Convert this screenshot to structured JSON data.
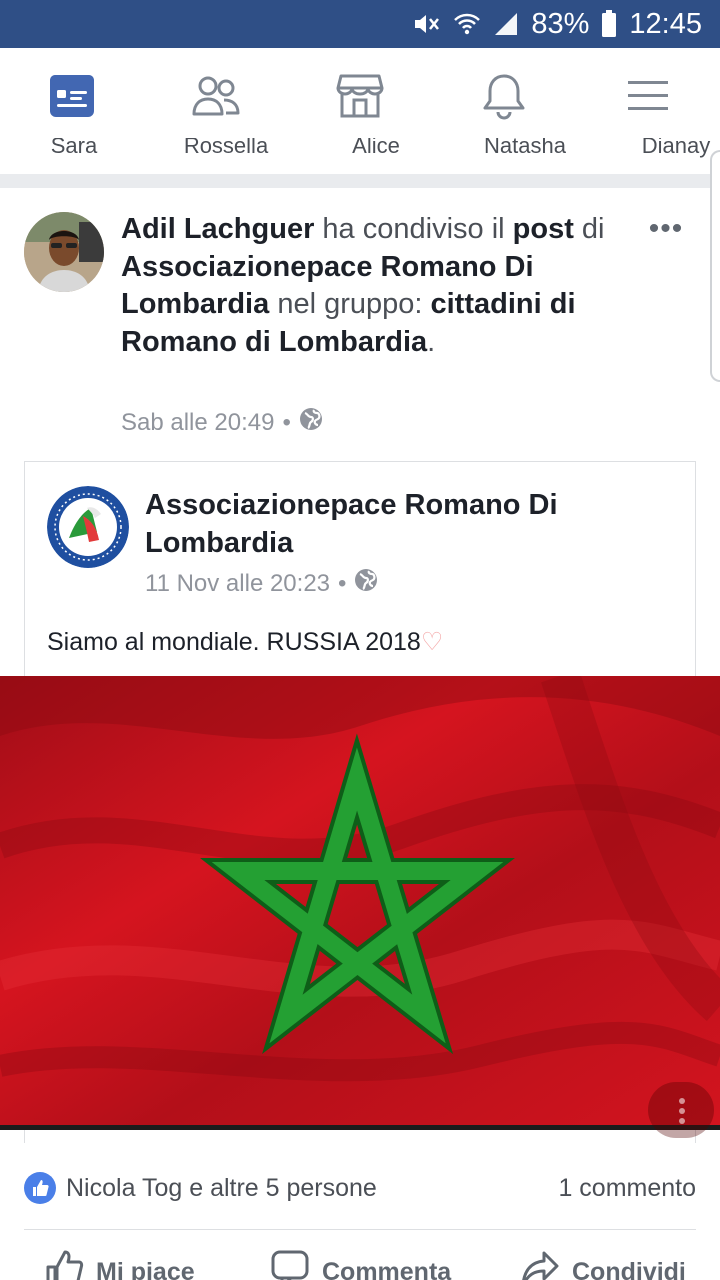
{
  "status_bar": {
    "battery": "83%",
    "time": "12:45",
    "icons": [
      "mute-icon",
      "wifi-icon",
      "signal-icon",
      "battery-icon"
    ]
  },
  "nav": {
    "icons": [
      "news-feed-icon",
      "friends-icon",
      "marketplace-icon",
      "notifications-icon",
      "menu-icon"
    ],
    "active": "news-feed-icon",
    "active_color": "#4267b2",
    "inactive_color": "#7f8792"
  },
  "stories": [
    "Sara",
    "Rossella",
    "Alice",
    "Natasha",
    "Dianay"
  ],
  "post": {
    "author": "Adil Lachguer",
    "action": "ha condiviso il",
    "post_word": "post",
    "of_word": "di",
    "source_page": "Associazionepace Romano Di Lombardia",
    "in_group_text": "nel gruppo:",
    "group": "cittadini di Romano di Lombardia",
    "period": ".",
    "time": "Sab alle 20:49",
    "audience_icon": "globe-icon",
    "more_icon": "more-icon"
  },
  "shared": {
    "page_name": "Associazionepace Romano Di Lombardia",
    "time": "11 Nov alle 20:23",
    "text": "Siamo al mondiale. RUSSIA 2018",
    "emoji": "♡",
    "image": "moroccan-flag",
    "flag_colors": {
      "red": "#c1121c",
      "green": "#1f8f2c"
    }
  },
  "engagement": {
    "reactions_text": "Nicola Tog e altre 5 persone",
    "comments_text": "1 commento"
  },
  "actions": {
    "like": "Mi piace",
    "comment": "Commenta",
    "share": "Condividi"
  }
}
